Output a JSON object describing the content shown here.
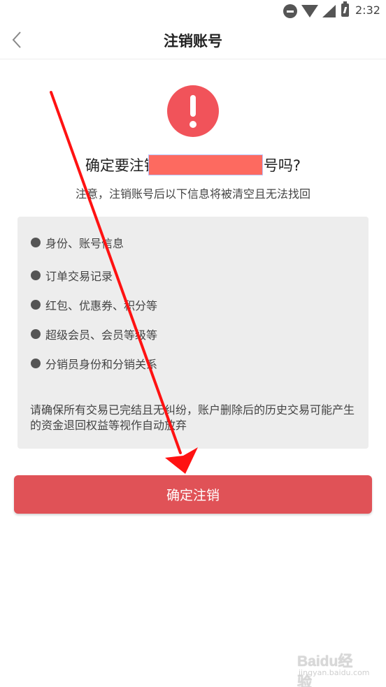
{
  "status_bar": {
    "time": "2:32",
    "icons": [
      "do-not-disturb-icon",
      "wifi-icon",
      "signal-icon",
      "battery-charging-icon"
    ]
  },
  "nav": {
    "title": "注销账号",
    "back_icon": "chevron-left-icon"
  },
  "alert": {
    "icon": "exclamation-icon",
    "color": "#f1535a",
    "headline_prefix": "确定要注销",
    "headline_suffix": "号吗?",
    "subtitle": "注意，注销账号后以下信息将被清空且无法找回"
  },
  "info": {
    "items": [
      "身份、账号信息",
      "订单交易记录",
      "红包、优惠券、积分等",
      "超级会员、会员等级等",
      "分销员身份和分销关系"
    ],
    "note": "请确保所有交易已完结且无纠纷，账户删除后的历史交易可能产生的资金退回权益等视作自动放弃"
  },
  "confirm_button": {
    "label": "确定注销",
    "color": "#e05257"
  },
  "annotation": {
    "arrow_color": "#ff0000"
  },
  "watermark": {
    "brand": "Baidu经验",
    "url": "jingyan.baidu.com"
  }
}
